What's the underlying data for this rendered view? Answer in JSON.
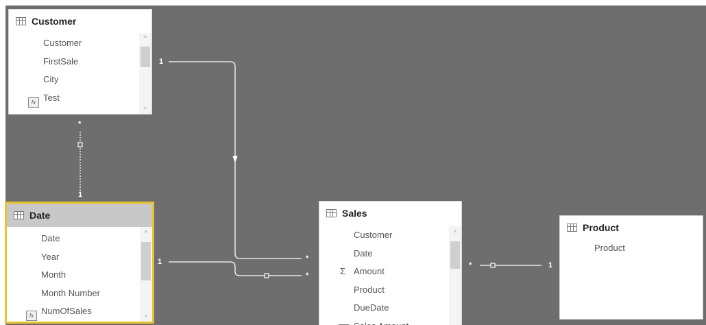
{
  "tables": {
    "customer": {
      "title": "Customer",
      "fields": [
        "Customer",
        "FirstSale",
        "City"
      ],
      "measure": "Test"
    },
    "date": {
      "title": "Date",
      "fields": [
        "Date",
        "Year",
        "Month",
        "Month Number"
      ],
      "measure": "NumOfSales"
    },
    "sales": {
      "title": "Sales",
      "fields": [
        "Customer",
        "Date"
      ],
      "sum_field": "Amount",
      "fields_after": [
        "Product",
        "DueDate"
      ],
      "partial_field": "Sales Amount"
    },
    "product": {
      "title": "Product",
      "fields": [
        "Product"
      ]
    }
  },
  "relationships": {
    "customer_sales": {
      "one": "1",
      "many": "*"
    },
    "customer_date": {
      "many": "*",
      "one": "1"
    },
    "date_sales": {
      "one": "1",
      "many": "*"
    },
    "sales_product": {
      "many": "*",
      "one": "1"
    }
  },
  "colors": {
    "canvas": "#6e6e6e",
    "selection": "#e8c530",
    "line": "#ffffff"
  },
  "icons": {
    "table": "table-icon",
    "measure": "measure-icon",
    "sum": "sigma-icon"
  }
}
